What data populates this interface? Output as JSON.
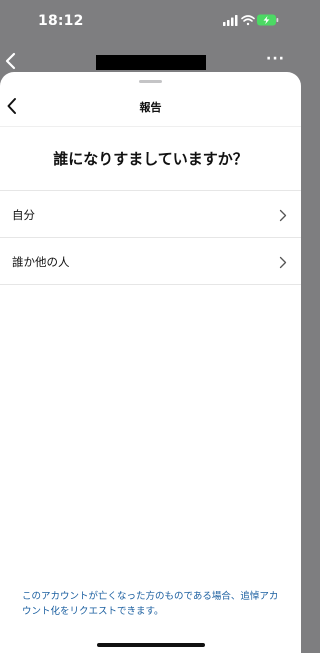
{
  "status_bar": {
    "time": "18:12",
    "icons": [
      "signal-icon",
      "wifi-icon",
      "battery-charging-icon"
    ]
  },
  "background": {
    "more_label": "···"
  },
  "sheet": {
    "title": "報告",
    "question": "誰になりすましていますか？",
    "options": [
      {
        "label": "自分"
      },
      {
        "label": "誰か他の人"
      }
    ],
    "footer_note": "このアカウントが亡くなった方のものである場合、追悼アカウント化をリクエストできます。"
  },
  "colors": {
    "link": "#1b5fa0",
    "battery": "#4cd964",
    "overlay": "#7e7e80"
  }
}
